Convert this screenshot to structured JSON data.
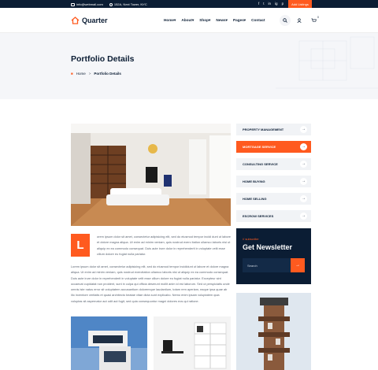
{
  "topbar": {
    "email": "info@webmail.com",
    "address": "152A, Next Tower, NYC",
    "social": [
      "f",
      "t",
      "in",
      "ig",
      "p"
    ],
    "add_listing": "Add Listings"
  },
  "brand": {
    "name": "Quarter",
    "accent": "#ff5a1f",
    "navy": "#0b1d34"
  },
  "nav": {
    "items": [
      "Home",
      "About",
      "Shop",
      "News",
      "Pages",
      "Contact"
    ]
  },
  "header_icons": [
    "search-icon",
    "user-icon",
    "cart-icon"
  ],
  "cart": {
    "count": "0"
  },
  "hero": {
    "title": "Portfolio Details",
    "crumb_home": "Home",
    "crumb_sep": ">",
    "crumb_current": "Portfolio Details"
  },
  "sidebar": {
    "items": [
      {
        "label": "PROPERTY MANAGEMENT"
      },
      {
        "label": "MORTGAGE SERVICE"
      },
      {
        "label": "CONSULTING SERVICE"
      },
      {
        "label": "HOME BUYING"
      },
      {
        "label": "HOME SELLING"
      },
      {
        "label": "ESCROW SERVICES"
      }
    ],
    "arrow": "→"
  },
  "article": {
    "dropcap": "L",
    "para1": "orem ipsum dolor sit amet, consectetur adipisicing elit, sed do eiusmod tempor incidi dunt ut labore et dolore magna aliqua. Ut enim ad minim veniam, quis nostrud exerc itation ullamco laboris nisi ut aliquip ex ea commodo consequat. Duis aute irure dolor in reprehenderit in voluptate velit esse cillum dolore eu fugiat nulla pariatur.",
    "para2": "Lorem ipsum dolor sit amet, consectetur adipisicing elit, sed do eiusmod tempor incididunt ut labore et dolore magna aliqua. Ut enim ad minim veniam, quis nostrud exercitation ullamco laboris nisi ut aliquip ex ea commodo consequat. Duis aute irure dolor in reprehenderit in voluptate velit esse cillum dolore eu fugiat nulla pariatur. Excepteur sint occaecat cupidatat non proident, sunt in culpa qui officia deserunt mollit anim id est laborum. Sed ut perspiciatis unde omnis iste natus error sit voluptatem accusantium doloremque laudantium, totam rem aperiam, eaque ipsa quae ab illo inventore veritatis et quasi architecto beatae vitae dicta sunt explicabo. Nemo enim ipsam voluptatem quia voluptas sit aspernatur aut odit aut fugit, sed quia consequuntur magni dolores eos qui ratione."
  },
  "newsletter": {
    "subtitle": "// subscribe",
    "title": "Get Newsletter",
    "placeholder": "Search"
  }
}
